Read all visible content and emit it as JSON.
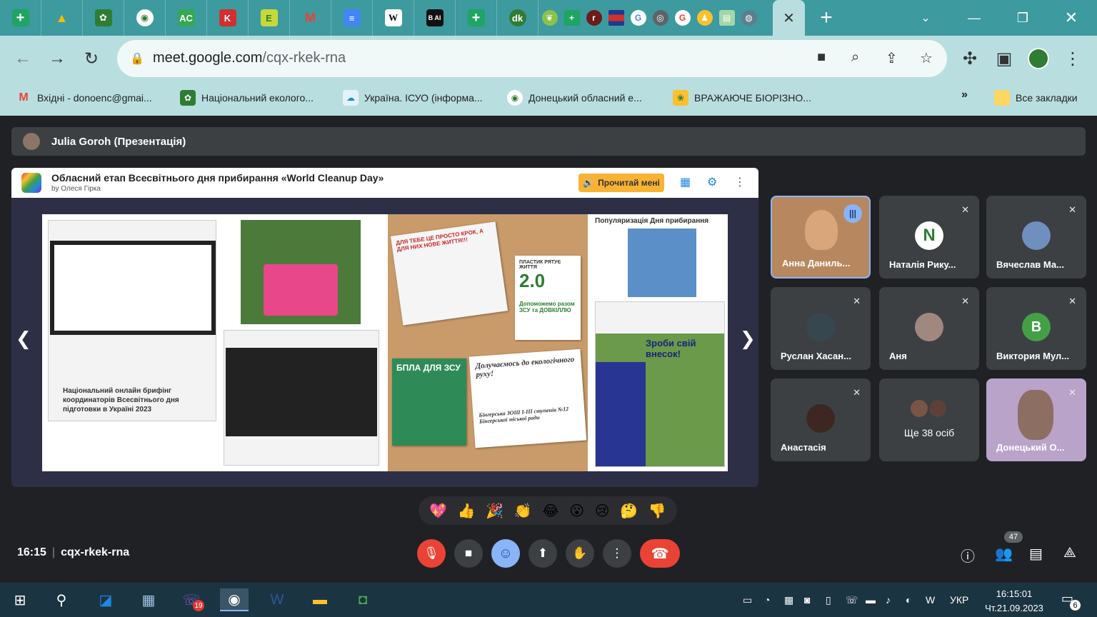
{
  "browser": {
    "url_host": "meet.google.com",
    "url_path": "/cqx-rkek-rna",
    "bookmarks": [
      {
        "label": "Вхідні - donoenc@gmai..."
      },
      {
        "label": "Національний еколого..."
      },
      {
        "label": "Україна. ІСУО (інформа..."
      },
      {
        "label": "Донецький обласний е..."
      },
      {
        "label": "ВРАЖАЮЧЕ БІОРІЗНО..."
      }
    ],
    "bookmarks_more": "»",
    "all_bookmarks": "Все закладки"
  },
  "meet": {
    "presenter_label": "Julia Goroh (Презентація)",
    "slide": {
      "title": "Обласний етап Всесвітнього дня прибирання «World Cleanup Day»",
      "author": "by Олеся Гірка",
      "read_button": "Прочитай мені",
      "left_caption": "Національний онлайн брифінг координаторів Всесвітнього дня підготовки в Україні 2023",
      "right_heading": "Популяризація Дня прибирання",
      "card_life": "ПЛАСТИК РЯТУЄ ЖИТТЯ",
      "card_life_num": "2.0",
      "card_help": "Допоможемо разом ЗСУ та ДОВКІЛЛЮ",
      "card_bpla": "БПЛА ДЛЯ ЗСУ",
      "card_join": "Долучаємось до екологічного руху!",
      "card_school": "Бінгерська ЗОШ І-ІІІ ступенів №12 Бінгерської міської ради",
      "card_step": "Зроби свій внесок!",
      "card_not_step": "ДЛЯ ТЕБЕ ЦЕ ПРОСТО КРОК, А ДЛЯ НИХ НОВЕ ЖИТТЯ!!!"
    },
    "participants": [
      {
        "name": "Анна Даниль...",
        "speaking": true
      },
      {
        "name": "Наталія Рику...",
        "initial": "N"
      },
      {
        "name": "Вячеслав Ма..."
      },
      {
        "name": "Руслан Хасан..."
      },
      {
        "name": "Аня"
      },
      {
        "name": "Виктория Мул...",
        "initial": "B"
      },
      {
        "name": "Анастасія"
      },
      {
        "name": "Ще 38 осіб"
      },
      {
        "name": "Донецький О..."
      }
    ],
    "reactions": [
      "💖",
      "👍",
      "🎉",
      "👏",
      "😂",
      "😮",
      "😢",
      "🤔",
      "👎"
    ],
    "time": "16:15",
    "meeting_code": "cqx-rkek-rna",
    "participant_count": "47"
  },
  "taskbar": {
    "viber_badge": "19",
    "lang": "УКР",
    "clock_time": "16:15:01",
    "clock_date": "Чт.21.09.2023",
    "notif_count": "6"
  },
  "colors": {
    "chrome_tab_bg": "#3d9a9f",
    "chrome_toolbar": "#b9dedf",
    "meet_bg": "#202124",
    "end_call": "#ea4335",
    "accent_blue": "#8ab4f8"
  }
}
